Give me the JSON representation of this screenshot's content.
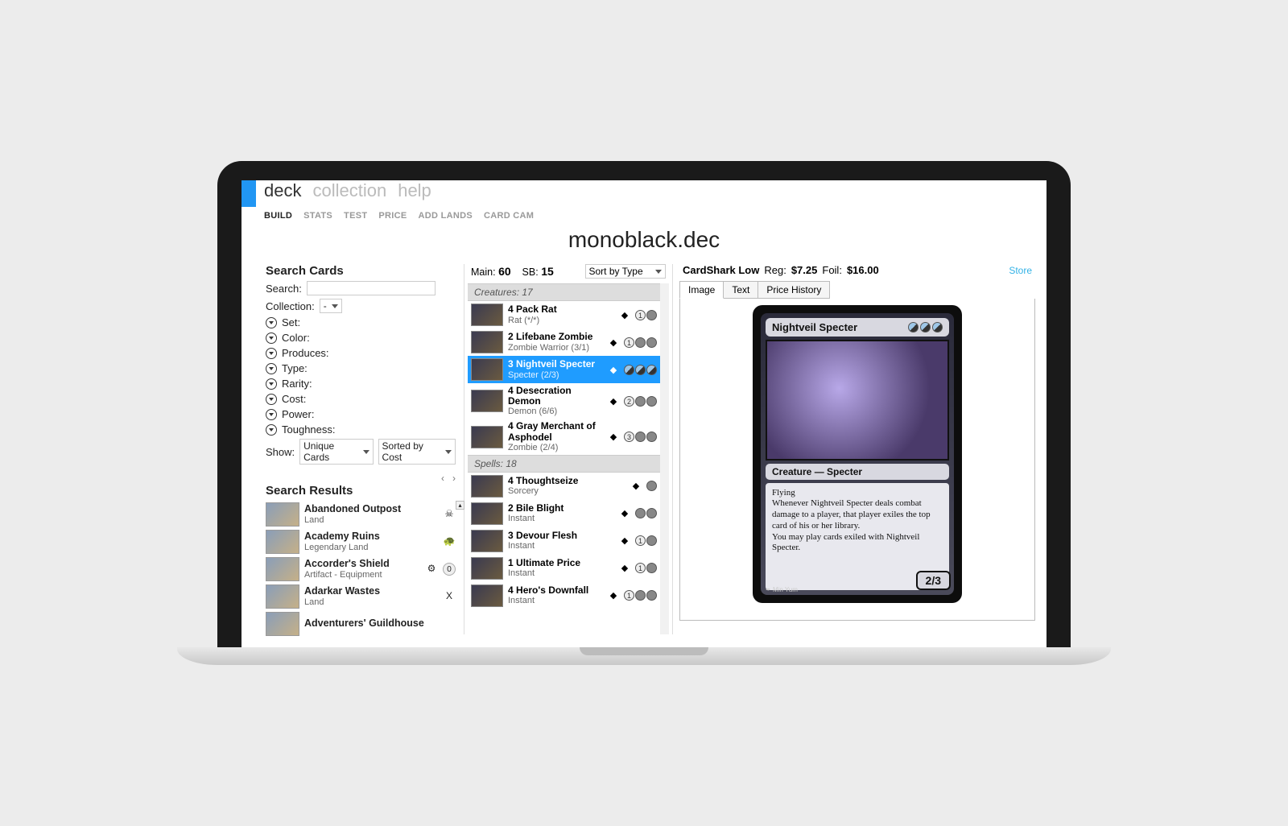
{
  "nav": {
    "tabs": [
      "deck",
      "collection",
      "help"
    ],
    "active": "deck",
    "sub": [
      "BUILD",
      "STATS",
      "TEST",
      "PRICE",
      "ADD LANDS",
      "CARD CAM"
    ],
    "subActive": "BUILD"
  },
  "title": "monoblack.dec",
  "search": {
    "heading": "Search Cards",
    "searchLabel": "Search:",
    "collectionLabel": "Collection:",
    "collectionValue": "-",
    "facets": [
      "Set:",
      "Color:",
      "Produces:",
      "Type:",
      "Rarity:",
      "Cost:",
      "Power:",
      "Toughness:"
    ],
    "showLabel": "Show:",
    "showValue": "Unique Cards",
    "sortValue": "Sorted by Cost",
    "resultsHeading": "Search Results",
    "results": [
      {
        "name": "Abandoned Outpost",
        "sub": "Land",
        "set": "☠"
      },
      {
        "name": "Academy Ruins",
        "sub": "Legendary Land",
        "set": "🐢"
      },
      {
        "name": "Accorder's Shield",
        "sub": "Artifact  - Equipment",
        "set": "⚙",
        "cost": "0"
      },
      {
        "name": "Adarkar Wastes",
        "sub": "Land",
        "set": "X"
      },
      {
        "name": "Adventurers' Guildhouse",
        "sub": "",
        "set": ""
      }
    ]
  },
  "deck": {
    "mainLabel": "Main:",
    "mainCount": "60",
    "sbLabel": "SB:",
    "sbCount": "15",
    "sortLabel": "Sort by Type",
    "groups": [
      {
        "header": "Creatures: 17",
        "rows": [
          {
            "qty": "4",
            "name": "Pack Rat",
            "sub": "Rat (*/*)",
            "mana": [
              {
                "t": "num",
                "v": "1"
              },
              {
                "t": "b"
              }
            ]
          },
          {
            "qty": "2",
            "name": "Lifebane Zombie",
            "sub": "Zombie Warrior (3/1)",
            "mana": [
              {
                "t": "num",
                "v": "1"
              },
              {
                "t": "b"
              },
              {
                "t": "b"
              }
            ]
          },
          {
            "qty": "3",
            "name": "Nightveil Specter",
            "sub": "Specter (2/3)",
            "sel": true,
            "mana": [
              {
                "t": "hybrid"
              },
              {
                "t": "hybrid"
              },
              {
                "t": "hybrid"
              }
            ]
          },
          {
            "qty": "4",
            "name": "Desecration Demon",
            "sub": "Demon (6/6)",
            "mana": [
              {
                "t": "num",
                "v": "2"
              },
              {
                "t": "b"
              },
              {
                "t": "b"
              }
            ]
          },
          {
            "qty": "4",
            "name": "Gray Merchant of Asphodel",
            "sub": "Zombie (2/4)",
            "mana": [
              {
                "t": "num",
                "v": "3"
              },
              {
                "t": "b"
              },
              {
                "t": "b"
              }
            ]
          }
        ]
      },
      {
        "header": "Spells: 18",
        "rows": [
          {
            "qty": "4",
            "name": "Thoughtseize",
            "sub": "Sorcery",
            "mana": [
              {
                "t": "b"
              }
            ]
          },
          {
            "qty": "2",
            "name": "Bile Blight",
            "sub": "Instant",
            "mana": [
              {
                "t": "b"
              },
              {
                "t": "b"
              }
            ]
          },
          {
            "qty": "3",
            "name": "Devour Flesh",
            "sub": "Instant",
            "mana": [
              {
                "t": "num",
                "v": "1"
              },
              {
                "t": "b"
              }
            ]
          },
          {
            "qty": "1",
            "name": "Ultimate Price",
            "sub": "Instant",
            "mana": [
              {
                "t": "num",
                "v": "1"
              },
              {
                "t": "b"
              }
            ]
          },
          {
            "qty": "4",
            "name": "Hero's Downfall",
            "sub": "Instant",
            "mana": [
              {
                "t": "num",
                "v": "1"
              },
              {
                "t": "b"
              },
              {
                "t": "b"
              }
            ]
          }
        ]
      }
    ]
  },
  "detail": {
    "priceSource": "CardShark Low",
    "regLabel": "Reg:",
    "regPrice": "$7.25",
    "foilLabel": "Foil:",
    "foilPrice": "$16.00",
    "storeLabel": "Store",
    "tabs": [
      "Image",
      "Text",
      "Price History"
    ],
    "activeTab": "Image",
    "card": {
      "name": "Nightveil Specter",
      "typeline": "Creature — Specter",
      "text1": "Flying",
      "text2": "Whenever Nightveil Specter deals combat damage to a player, that player exiles the top card of his or her library.",
      "text3": "You may play cards exiled with Nightveil Specter.",
      "pt": "2/3",
      "artist": "Min Yum"
    }
  }
}
